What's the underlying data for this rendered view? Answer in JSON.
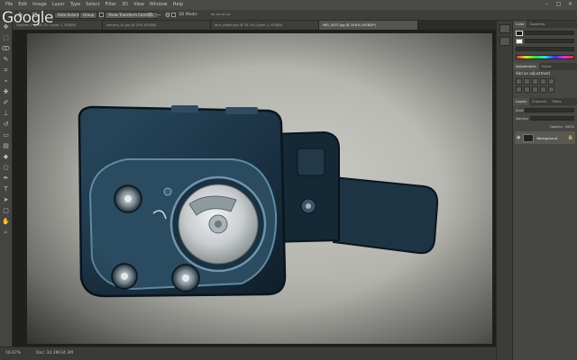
{
  "watermark": {
    "logo_text": "Google"
  },
  "menu": {
    "items": [
      "File",
      "Edit",
      "Image",
      "Layer",
      "Type",
      "Select",
      "Filter",
      "3D",
      "View",
      "Window",
      "Help"
    ]
  },
  "window_controls": {
    "minimize": "–",
    "maximize": "□",
    "close": "×"
  },
  "options_bar": {
    "auto_select_label": "Auto-Select:",
    "auto_select_value": "Group",
    "show_transform_label": "Show Transform Controls",
    "mode_3d_label": "3D Mode:"
  },
  "tabs": [
    {
      "label": "Untitled-1 @ 66.7% (Layer 1, RGB/8)"
    },
    {
      "label": "camera_01.jpg @ 25% (RGB/8)"
    },
    {
      "label": "lens_detail.psd @ 33.3% (Layer 2, RGB/8)"
    },
    {
      "label": "IMG_4207.jpg @ 20.8% (RGB/8*)",
      "active": true
    }
  ],
  "status": {
    "zoom": "16.67%",
    "doc_info": "Doc: 34.3M/34.3M"
  },
  "panels": {
    "color_tabs": [
      "Color",
      "Swatches"
    ],
    "adjust_tabs": [
      "Adjustments",
      "Styles"
    ],
    "adjust_heading": "Add an adjustment",
    "layers_tabs": [
      "Layers",
      "Channels",
      "Paths"
    ],
    "layer_kind": "Kind",
    "blend_mode": "Normal",
    "opacity_label": "Opacity:",
    "opacity_value": "100%",
    "layers": [
      {
        "name": "Background"
      }
    ]
  },
  "colors": {
    "app_bg": "#3a3a38",
    "canvas_bg": "#1f1f1e",
    "camera_body": "#1c3547",
    "camera_highlight": "#4a6f86",
    "dial_silver": "#c8ccce",
    "foreground_swatch": "#1a1a1a",
    "background_swatch": "#f2f2f2"
  }
}
